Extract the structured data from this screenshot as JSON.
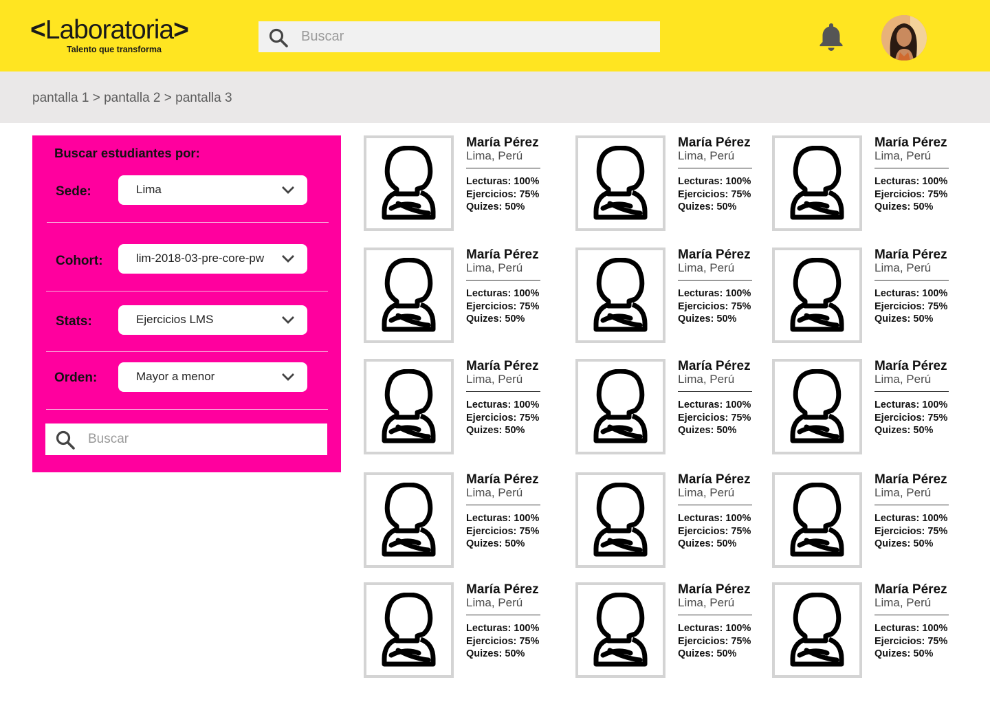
{
  "header": {
    "logo_chevron_left": "<",
    "logo_text": "Laboratoria",
    "logo_chevron_right": ">",
    "logo_tagline": "Talento que transforma",
    "search_placeholder": "Buscar",
    "icons": {
      "search": "search-icon",
      "bell": "bell-icon",
      "avatar": "user-avatar"
    }
  },
  "breadcrumb": {
    "items": [
      "pantalla 1",
      "pantalla 2",
      "pantalla 3"
    ],
    "separator": ">"
  },
  "filters": {
    "title": "Buscar estudiantes por:",
    "rows": [
      {
        "label": "Sede:",
        "value": "Lima"
      },
      {
        "label": "Cohort:",
        "value": "lim-2018-03-pre-core-pw"
      },
      {
        "label": "Stats:",
        "value": "Ejercicios LMS"
      },
      {
        "label": "Orden:",
        "value": "Mayor a menor"
      }
    ],
    "search_placeholder": "Buscar"
  },
  "students": [
    {
      "name": "María Pérez",
      "location": "Lima, Perú",
      "lecturas": "Lecturas: 100%",
      "ejercicios": "Ejercicios: 75%",
      "quizes": "Quizes: 50%"
    },
    {
      "name": "María Pérez",
      "location": "Lima, Perú",
      "lecturas": "Lecturas: 100%",
      "ejercicios": "Ejercicios: 75%",
      "quizes": "Quizes: 50%"
    },
    {
      "name": "María Pérez",
      "location": "Lima, Perú",
      "lecturas": "Lecturas: 100%",
      "ejercicios": "Ejercicios: 75%",
      "quizes": "Quizes: 50%"
    },
    {
      "name": "María Pérez",
      "location": "Lima, Perú",
      "lecturas": "Lecturas: 100%",
      "ejercicios": "Ejercicios: 75%",
      "quizes": "Quizes: 50%"
    },
    {
      "name": "María Pérez",
      "location": "Lima, Perú",
      "lecturas": "Lecturas: 100%",
      "ejercicios": "Ejercicios: 75%",
      "quizes": "Quizes: 50%"
    },
    {
      "name": "María Pérez",
      "location": "Lima, Perú",
      "lecturas": "Lecturas: 100%",
      "ejercicios": "Ejercicios: 75%",
      "quizes": "Quizes: 50%"
    },
    {
      "name": "María Pérez",
      "location": "Lima, Perú",
      "lecturas": "Lecturas: 100%",
      "ejercicios": "Ejercicios: 75%",
      "quizes": "Quizes: 50%"
    },
    {
      "name": "María Pérez",
      "location": "Lima, Perú",
      "lecturas": "Lecturas: 100%",
      "ejercicios": "Ejercicios: 75%",
      "quizes": "Quizes: 50%"
    },
    {
      "name": "María Pérez",
      "location": "Lima, Perú",
      "lecturas": "Lecturas: 100%",
      "ejercicios": "Ejercicios: 75%",
      "quizes": "Quizes: 50%"
    },
    {
      "name": "María Pérez",
      "location": "Lima, Perú",
      "lecturas": "Lecturas: 100%",
      "ejercicios": "Ejercicios: 75%",
      "quizes": "Quizes: 50%"
    },
    {
      "name": "María Pérez",
      "location": "Lima, Perú",
      "lecturas": "Lecturas: 100%",
      "ejercicios": "Ejercicios: 75%",
      "quizes": "Quizes: 50%"
    },
    {
      "name": "María Pérez",
      "location": "Lima, Perú",
      "lecturas": "Lecturas: 100%",
      "ejercicios": "Ejercicios: 75%",
      "quizes": "Quizes: 50%"
    },
    {
      "name": "María Pérez",
      "location": "Lima, Perú",
      "lecturas": "Lecturas: 100%",
      "ejercicios": "Ejercicios: 75%",
      "quizes": "Quizes: 50%"
    },
    {
      "name": "María Pérez",
      "location": "Lima, Perú",
      "lecturas": "Lecturas: 100%",
      "ejercicios": "Ejercicios: 75%",
      "quizes": "Quizes: 50%"
    },
    {
      "name": "María Pérez",
      "location": "Lima, Perú",
      "lecturas": "Lecturas: 100%",
      "ejercicios": "Ejercicios: 75%",
      "quizes": "Quizes: 50%"
    }
  ],
  "colors": {
    "header_bg": "#ffe521",
    "breadcrumb_bg": "#eae8e8",
    "panel_bg": "#ff009e",
    "photo_border": "#d4d4d4"
  }
}
